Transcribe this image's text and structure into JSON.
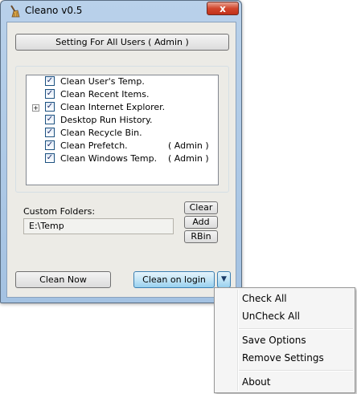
{
  "window": {
    "title": "Cleano v0.5",
    "close_label": "x"
  },
  "settings_button": "Setting For All Users  ( Admin )",
  "options": [
    {
      "label": "Clean User's Temp.",
      "checked": true,
      "suffix": "",
      "expandable": false
    },
    {
      "label": "Clean Recent Items.",
      "checked": true,
      "suffix": "",
      "expandable": false
    },
    {
      "label": "Clean Internet Explorer.",
      "checked": true,
      "suffix": "",
      "expandable": true
    },
    {
      "label": "Desktop Run History.",
      "checked": true,
      "suffix": "",
      "expandable": false
    },
    {
      "label": "Clean Recycle Bin.",
      "checked": true,
      "suffix": "",
      "expandable": false
    },
    {
      "label": "Clean Prefetch.",
      "checked": true,
      "suffix": "( Admin )",
      "expandable": false
    },
    {
      "label": "Clean Windows Temp.",
      "checked": true,
      "suffix": "( Admin )",
      "expandable": false
    }
  ],
  "custom_folders": {
    "label": "Custom Folders:",
    "value": "E:\\Temp",
    "clear_label": "Clear",
    "add_label": "Add",
    "rbin_label": "RBin"
  },
  "bottom": {
    "clean_now_label": "Clean  Now",
    "clean_on_login_label": "Clean on login",
    "dropdown_arrow": "▼"
  },
  "context_menu": {
    "check_all": "Check All",
    "uncheck_all": "UnCheck All",
    "save_options": "Save Options",
    "remove_settings": "Remove Settings",
    "about": "About"
  },
  "colors": {
    "window_frame": "#a4c2e2",
    "client_bg": "#ecebe6",
    "close_button": "#c1311a",
    "active_button": "#98d1ef",
    "checkmark": "#1b2e6a"
  },
  "icons": {
    "app": "broom-icon",
    "expander": "plus-expander-icon",
    "checkbox": "checkmark-icon",
    "dropdown": "down-arrow-icon"
  }
}
